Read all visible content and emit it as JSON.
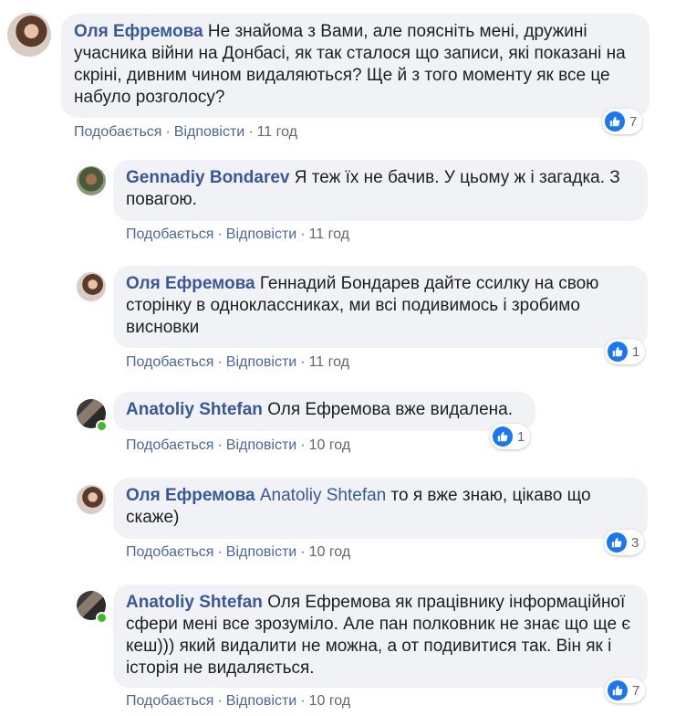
{
  "actions": {
    "like": "Подобається",
    "reply": "Відповісти",
    "separator": "·"
  },
  "colors": {
    "author": "#385898",
    "bubble": "#f0f2f5",
    "like": "#1877f2",
    "online": "#42b72a"
  },
  "comments": [
    {
      "author": "Оля Ефремова",
      "text": "Не знайома з Вами, але поясніть мені, дружині учасника війни на Донбасі, як так сталося що записи, які показані на скріні, дивним чином видаляються? Ще й з того моменту як все це набуло розголосу?",
      "time": "11 год",
      "likes": "7"
    },
    {
      "author": "Gennadiy Bondarev",
      "text": "Я теж їх не бачив. У цьому ж і загадка. З повагою.",
      "time": "11 год"
    },
    {
      "author": "Оля Ефремова",
      "text": "Геннадий Бондарев дайте ссилку на свою сторінку в одноклассниках, ми всі подивимось і зробимо висновки",
      "time": "11 год",
      "likes": "1"
    },
    {
      "author": "Anatoliy Shtefan",
      "text": "Оля Ефремова вже видалена.",
      "time": "10 год",
      "likes": "1",
      "online": true
    },
    {
      "author": "Оля Ефремова",
      "mention": "Anatoliy Shtefan",
      "text": "то я вже знаю, цікаво що скаже)",
      "time": "10 год",
      "likes": "3"
    },
    {
      "author": "Anatoliy Shtefan",
      "text": "Оля Ефремова як працівнику інформаційної сфери мені все зрозуміло. Але пан полковник не знає що ще є кеш))) який видалити не можна, а от подивитися так. Він як і історія не видаляється.",
      "time": "10 год",
      "likes": "7",
      "online": true
    }
  ]
}
